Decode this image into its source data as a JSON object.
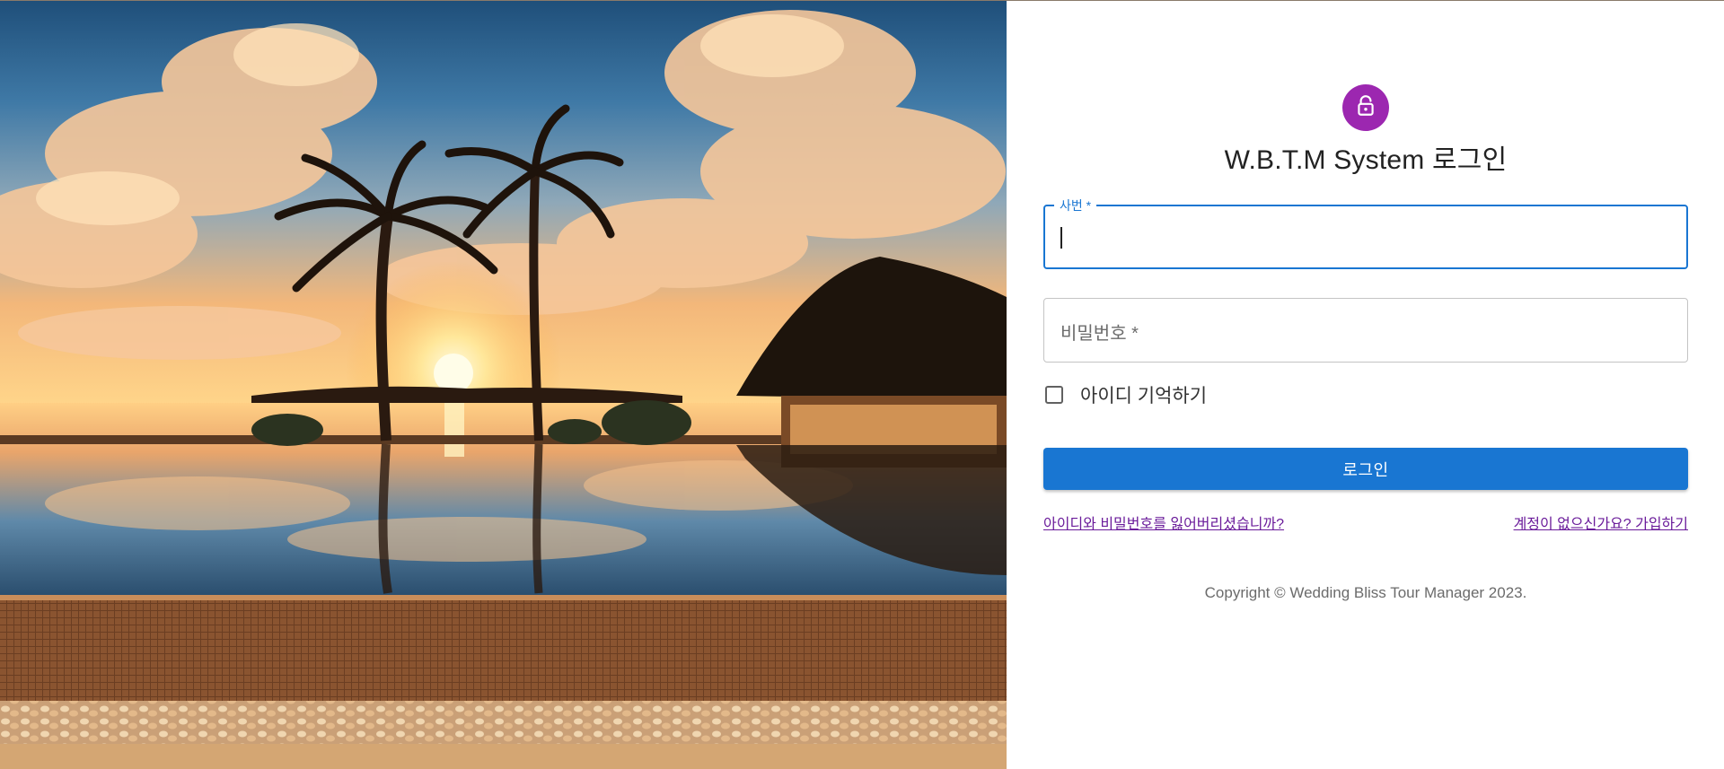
{
  "hero": {
    "icon": "tropical-sunset-photo"
  },
  "login": {
    "avatar_icon": "lock-icon",
    "avatar_color": "#9c27b0",
    "title": "W.B.T.M System 로그인",
    "employee_id": {
      "label": "사번 *",
      "value": ""
    },
    "password": {
      "placeholder": "비밀번호 *",
      "value": ""
    },
    "remember_label": "아이디 기억하기",
    "remember_checked": false,
    "submit_label": "로그인",
    "submit_color": "#1976d2",
    "forgot_link": "아이디와 비밀번호를 잃어버리셨습니까?",
    "signup_link": "계정이 없으신가요? 가입하기",
    "link_color": "#6a1b9a",
    "copyright": "Copyright © Wedding Bliss Tour Manager 2023."
  }
}
